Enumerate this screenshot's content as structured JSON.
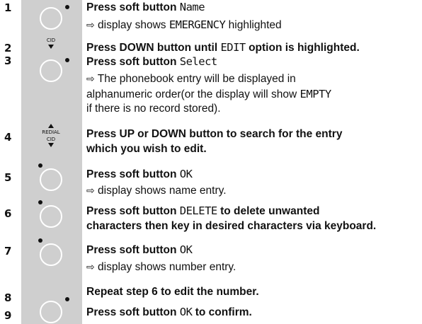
{
  "steps": [
    {
      "num": "1",
      "lines": [
        {
          "pre": "Press soft button ",
          "mono": "Name",
          "post": "",
          "bold": true
        },
        {
          "arrow": "⇨",
          "pre": " display shows ",
          "mono": "EMERGENCY",
          "post": " highlighted",
          "bold": false
        }
      ]
    },
    {
      "num": "2",
      "lines": [
        {
          "pre": "Press DOWN button until ",
          "mono": "EDIT",
          "post": " option is highlighted.",
          "bold": true
        }
      ]
    },
    {
      "num": "3",
      "lines": [
        {
          "pre": "Press soft button ",
          "mono": "Select",
          "post": "",
          "bold": true
        },
        {
          "arrow": "⇨",
          "pre": " The phonebook entry will be displayed in",
          "mono": "",
          "post": "",
          "bold": false
        },
        {
          "pre": "alphanumeric order(or the display will show ",
          "mono": "EMPTY",
          "post": "",
          "bold": false
        },
        {
          "pre": "if there is no record stored).",
          "mono": "",
          "post": "",
          "bold": false
        }
      ]
    },
    {
      "num": "4",
      "lines": [
        {
          "pre": "Press UP or DOWN button to search for the entry",
          "mono": "",
          "post": "",
          "bold": true
        },
        {
          "pre": "which you wish to edit.",
          "mono": "",
          "post": "",
          "bold": true
        }
      ]
    },
    {
      "num": "5",
      "lines": [
        {
          "pre": "Press soft button ",
          "mono": "OK",
          "post": "",
          "bold": true
        },
        {
          "arrow": "⇨",
          "pre": " display shows name entry.",
          "mono": "",
          "post": "",
          "bold": false
        }
      ]
    },
    {
      "num": "6",
      "lines": [
        {
          "pre": "Press soft button ",
          "mono": "DELETE",
          "post": " to delete unwanted",
          "bold": true
        },
        {
          "pre": "characters then key in desired characters via keyboard.",
          "mono": "",
          "post": "",
          "bold": true
        }
      ]
    },
    {
      "num": "7",
      "lines": [
        {
          "pre": "Press soft button ",
          "mono": "OK",
          "post": "",
          "bold": true
        },
        {
          "arrow": "⇨",
          "pre": " display shows number entry.",
          "mono": "",
          "post": "",
          "bold": false
        }
      ]
    },
    {
      "num": "8",
      "lines": [
        {
          "pre": "Repeat step 6 to edit the number.",
          "mono": "",
          "post": "",
          "bold": true
        }
      ]
    },
    {
      "num": "9",
      "lines": [
        {
          "pre": "Press soft button ",
          "mono": "OK",
          "post": " to confirm.",
          "bold": true
        }
      ]
    }
  ],
  "icon_labels": {
    "cid": "CID",
    "redial": "REDIAL",
    "cid2": "CID"
  }
}
